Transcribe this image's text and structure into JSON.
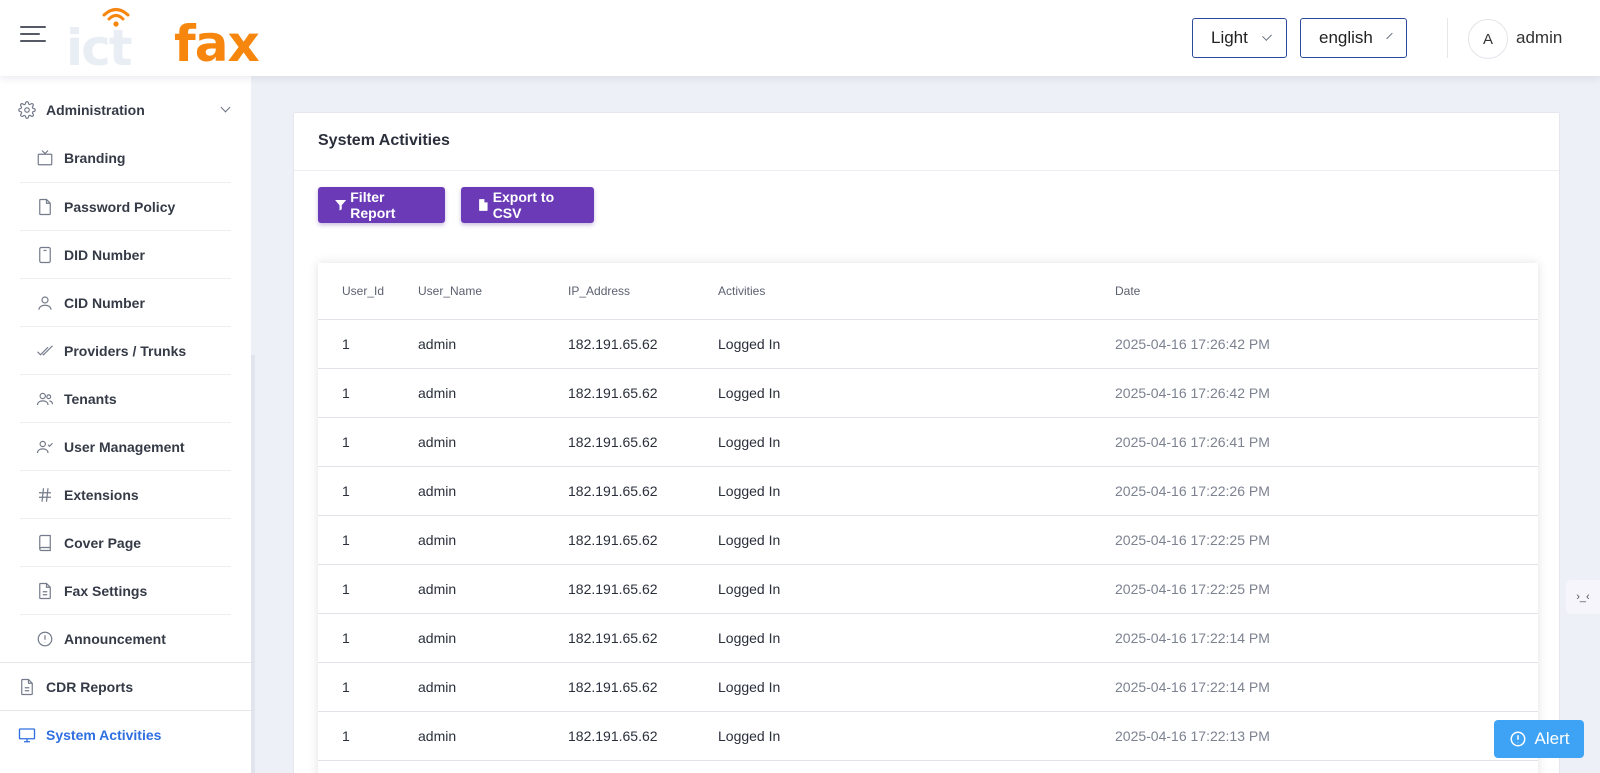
{
  "header": {
    "logo_text": "fax",
    "logo_faded": "ict",
    "theme_value": "Light",
    "language_value": "english",
    "avatar_initial": "A",
    "username": "admin"
  },
  "sidebar": {
    "parent_admin": "Administration",
    "children": [
      {
        "label": "Branding",
        "icon": "tv-icon"
      },
      {
        "label": "Password Policy",
        "icon": "document-icon"
      },
      {
        "label": "DID Number",
        "icon": "tablet-icon"
      },
      {
        "label": "CID Number",
        "icon": "user-icon"
      },
      {
        "label": "Providers / Trunks",
        "icon": "double-check-icon"
      },
      {
        "label": "Tenants",
        "icon": "users-icon"
      },
      {
        "label": "User Management",
        "icon": "user-check-icon"
      },
      {
        "label": "Extensions",
        "icon": "hash-icon"
      },
      {
        "label": "Cover Page",
        "icon": "book-icon"
      },
      {
        "label": "Fax Settings",
        "icon": "file-text-icon"
      },
      {
        "label": "Announcement",
        "icon": "alert-circle-icon"
      }
    ],
    "cdr_reports": "CDR Reports",
    "system_activities": "System Activities"
  },
  "main": {
    "title": "System Activities",
    "filter_label": "Filter Report",
    "export_label": "Export to CSV",
    "columns": [
      "User_Id",
      "User_Name",
      "IP_Address",
      "Activities",
      "Date"
    ],
    "rows": [
      [
        "1",
        "admin",
        "182.191.65.62",
        "Logged In",
        "2025-04-16 17:26:42 PM"
      ],
      [
        "1",
        "admin",
        "182.191.65.62",
        "Logged In",
        "2025-04-16 17:26:42 PM"
      ],
      [
        "1",
        "admin",
        "182.191.65.62",
        "Logged In",
        "2025-04-16 17:26:41 PM"
      ],
      [
        "1",
        "admin",
        "182.191.65.62",
        "Logged In",
        "2025-04-16 17:22:26 PM"
      ],
      [
        "1",
        "admin",
        "182.191.65.62",
        "Logged In",
        "2025-04-16 17:22:25 PM"
      ],
      [
        "1",
        "admin",
        "182.191.65.62",
        "Logged In",
        "2025-04-16 17:22:25 PM"
      ],
      [
        "1",
        "admin",
        "182.191.65.62",
        "Logged In",
        "2025-04-16 17:22:14 PM"
      ],
      [
        "1",
        "admin",
        "182.191.65.62",
        "Logged In",
        "2025-04-16 17:22:14 PM"
      ],
      [
        "1",
        "admin",
        "182.191.65.62",
        "Logged In",
        "2025-04-16 17:22:13 PM"
      ]
    ]
  },
  "widgets": {
    "side_tab": "›_‹",
    "alert_label": "Alert"
  },
  "colors": {
    "brand_orange": "#f7860f",
    "button_purple": "#6b3bb7",
    "active_blue": "#2f6fe0",
    "alert_blue": "#3fa3f5"
  }
}
